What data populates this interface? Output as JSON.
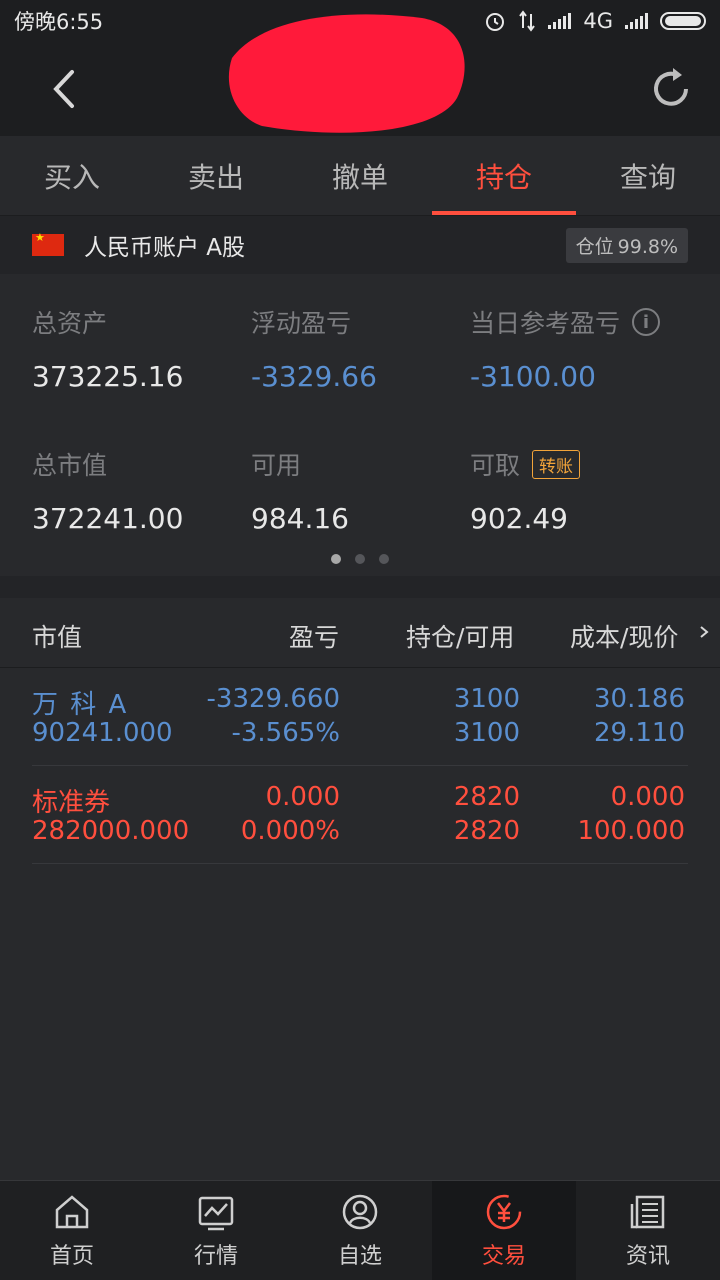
{
  "status_bar": {
    "time": "傍晚6:55",
    "network": "4G"
  },
  "tabs": [
    {
      "label": "买入",
      "active": false
    },
    {
      "label": "卖出",
      "active": false
    },
    {
      "label": "撤单",
      "active": false
    },
    {
      "label": "持仓",
      "active": true
    },
    {
      "label": "查询",
      "active": false
    }
  ],
  "account": {
    "name": "人民币账户 A股",
    "position_label": "仓位",
    "position_value": "99.8%"
  },
  "summary": {
    "total_assets": {
      "label": "总资产",
      "value": "373225.16"
    },
    "floating_pl": {
      "label": "浮动盈亏",
      "value": "-3329.66"
    },
    "daily_pl": {
      "label": "当日参考盈亏",
      "value": "-3100.00"
    },
    "market_value": {
      "label": "总市值",
      "value": "372241.00"
    },
    "available": {
      "label": "可用",
      "value": "984.16"
    },
    "withdrawable": {
      "label": "可取",
      "value": "902.49",
      "button": "转账"
    },
    "page_index": 0,
    "page_count": 3
  },
  "holdings": {
    "headers": {
      "col1": "市值",
      "col2": "盈亏",
      "col3": "持仓/可用",
      "col4": "成本/现价"
    },
    "rows": [
      {
        "name": "万 科 A",
        "market_value": "90241.000",
        "pl": "-3329.660",
        "pl_pct": "-3.565%",
        "holding": "3100",
        "available": "3100",
        "cost": "30.186",
        "price": "29.110"
      },
      {
        "name": "标准券",
        "market_value": "282000.000",
        "pl": "0.000",
        "pl_pct": "0.000%",
        "holding": "2820",
        "available": "2820",
        "cost": "0.000",
        "price": "100.000"
      }
    ]
  },
  "bottom_nav": [
    {
      "label": "首页",
      "icon": "home-icon"
    },
    {
      "label": "行情",
      "icon": "chart-icon"
    },
    {
      "label": "自选",
      "icon": "user-circle-icon"
    },
    {
      "label": "交易",
      "icon": "yuan-icon",
      "active": true
    },
    {
      "label": "资讯",
      "icon": "news-icon"
    }
  ],
  "colors": {
    "accent": "#ff4f3e",
    "loss_blue": "#5a8fd0",
    "warning": "#f2a43a"
  }
}
